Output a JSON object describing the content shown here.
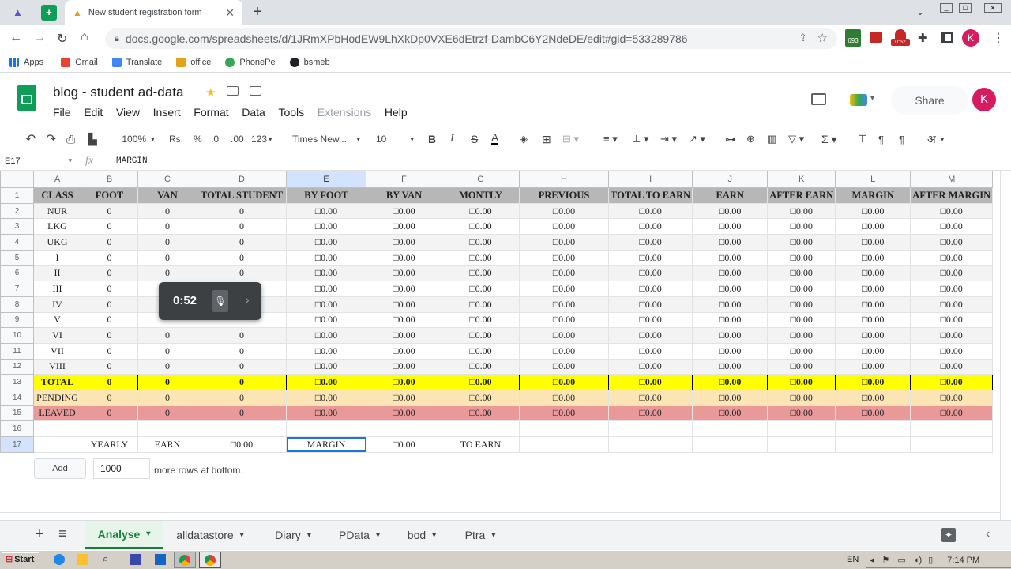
{
  "browser": {
    "tabs": [
      {
        "label": "New student registration form"
      }
    ],
    "new_tab_icon": "plus-icon",
    "url": "docs.google.com/spreadsheets/d/1JRmXPbHodEW9LhXkDp0VXE6dEtrzf-DambC6Y2NdeDE/edit#gid=533289786",
    "ext_badges": {
      "calendar": "693",
      "recorder": "0:52"
    },
    "profile_initial": "K"
  },
  "bookmarks": [
    {
      "label": "Apps"
    },
    {
      "label": "Gmail"
    },
    {
      "label": "Translate"
    },
    {
      "label": "office"
    },
    {
      "label": "PhonePe"
    },
    {
      "label": "bsmeb"
    }
  ],
  "doc": {
    "title": "blog - student ad-data",
    "menus": [
      "File",
      "Edit",
      "View",
      "Insert",
      "Format",
      "Data",
      "Tools",
      "Extensions",
      "Help"
    ],
    "share_label": "Share",
    "avatar": "K"
  },
  "toolbar": {
    "zoom": "100%",
    "currency": "Rs.",
    "percent": "%",
    "dec_less": ".0",
    "dec_more": ".00",
    "format": "123",
    "font": "Times New...",
    "size": "10",
    "bold": "B",
    "italic": "I",
    "strike": "S",
    "text_color": "A",
    "lang": "अ"
  },
  "formula": {
    "cell_ref": "E17",
    "fx": "fx",
    "content": "MARGIN"
  },
  "grid": {
    "columns": [
      "A",
      "B",
      "C",
      "D",
      "E",
      "F",
      "G",
      "H",
      "I",
      "J",
      "K",
      "L",
      "M"
    ],
    "selected_column": "E",
    "rows": [
      {
        "n": "1",
        "type": "hdr",
        "cells": [
          "CLASS",
          "FOOT",
          "VAN",
          "TOTAL STUDENT",
          "BY FOOT",
          "BY VAN",
          "MONTLY",
          "PREVIOUS",
          "TOTAL TO EARN",
          "EARN",
          "AFTER EARN",
          "MARGIN",
          "AFTER MARGIN"
        ]
      },
      {
        "n": "2",
        "type": "r2",
        "cells": [
          "NUR",
          "0",
          "0",
          "0",
          "□0.00",
          "□0.00",
          "□0.00",
          "□0.00",
          "□0.00",
          "□0.00",
          "□0.00",
          "□0.00",
          "□0.00"
        ]
      },
      {
        "n": "3",
        "type": "r3",
        "cells": [
          "LKG",
          "0",
          "0",
          "0",
          "□0.00",
          "□0.00",
          "□0.00",
          "□0.00",
          "□0.00",
          "□0.00",
          "□0.00",
          "□0.00",
          "□0.00"
        ]
      },
      {
        "n": "4",
        "type": "r4",
        "cells": [
          "UKG",
          "0",
          "0",
          "0",
          "□0.00",
          "□0.00",
          "□0.00",
          "□0.00",
          "□0.00",
          "□0.00",
          "□0.00",
          "□0.00",
          "□0.00"
        ]
      },
      {
        "n": "5",
        "type": "r5",
        "cells": [
          "I",
          "0",
          "0",
          "0",
          "□0.00",
          "□0.00",
          "□0.00",
          "□0.00",
          "□0.00",
          "□0.00",
          "□0.00",
          "□0.00",
          "□0.00"
        ]
      },
      {
        "n": "6",
        "type": "r6",
        "cells": [
          "II",
          "0",
          "0",
          "0",
          "□0.00",
          "□0.00",
          "□0.00",
          "□0.00",
          "□0.00",
          "□0.00",
          "□0.00",
          "□0.00",
          "□0.00"
        ]
      },
      {
        "n": "7",
        "type": "r7",
        "cells": [
          "III",
          "0",
          "",
          "",
          "□0.00",
          "□0.00",
          "□0.00",
          "□0.00",
          "□0.00",
          "□0.00",
          "□0.00",
          "□0.00",
          "□0.00"
        ]
      },
      {
        "n": "8",
        "type": "r8",
        "cells": [
          "IV",
          "0",
          "",
          "",
          "□0.00",
          "□0.00",
          "□0.00",
          "□0.00",
          "□0.00",
          "□0.00",
          "□0.00",
          "□0.00",
          "□0.00"
        ]
      },
      {
        "n": "9",
        "type": "r9",
        "cells": [
          "V",
          "0",
          "",
          "",
          "□0.00",
          "□0.00",
          "□0.00",
          "□0.00",
          "□0.00",
          "□0.00",
          "□0.00",
          "□0.00",
          "□0.00"
        ]
      },
      {
        "n": "10",
        "type": "r10",
        "cells": [
          "VI",
          "0",
          "0",
          "0",
          "□0.00",
          "□0.00",
          "□0.00",
          "□0.00",
          "□0.00",
          "□0.00",
          "□0.00",
          "□0.00",
          "□0.00"
        ]
      },
      {
        "n": "11",
        "type": "r11",
        "cells": [
          "VII",
          "0",
          "0",
          "0",
          "□0.00",
          "□0.00",
          "□0.00",
          "□0.00",
          "□0.00",
          "□0.00",
          "□0.00",
          "□0.00",
          "□0.00"
        ]
      },
      {
        "n": "12",
        "type": "r12",
        "cells": [
          "VIII",
          "0",
          "0",
          "0",
          "□0.00",
          "□0.00",
          "□0.00",
          "□0.00",
          "□0.00",
          "□0.00",
          "□0.00",
          "□0.00",
          "□0.00"
        ]
      },
      {
        "n": "13",
        "type": "total",
        "cells": [
          "TOTAL",
          "0",
          "0",
          "0",
          "□0.00",
          "□0.00",
          "□0.00",
          "□0.00",
          "□0.00",
          "□0.00",
          "□0.00",
          "□0.00",
          "□0.00"
        ]
      },
      {
        "n": "14",
        "type": "pending",
        "cells": [
          "PENDING",
          "0",
          "0",
          "0",
          "□0.00",
          "□0.00",
          "□0.00",
          "□0.00",
          "□0.00",
          "□0.00",
          "□0.00",
          "□0.00",
          "□0.00"
        ]
      },
      {
        "n": "15",
        "type": "leaved",
        "cells": [
          "LEAVED",
          "0",
          "0",
          "0",
          "□0.00",
          "□0.00",
          "□0.00",
          "□0.00",
          "□0.00",
          "□0.00",
          "□0.00",
          "□0.00",
          "□0.00"
        ]
      },
      {
        "n": "16",
        "type": "blank",
        "cells": [
          "",
          "",
          "",
          "",
          "",
          "",
          "",
          "",
          "",
          "",
          "",
          "",
          ""
        ]
      },
      {
        "n": "17",
        "type": "r17",
        "cells": [
          "",
          "YEARLY",
          "EARN",
          "□0.00",
          "MARGIN",
          "□0.00",
          "TO EARN",
          "",
          "",
          "",
          "",
          "",
          ""
        ]
      }
    ],
    "add_rows": {
      "button": "Add",
      "count": "1000",
      "suffix": "more rows at bottom."
    }
  },
  "recorder_popup": {
    "time": "0:52"
  },
  "sheets": [
    {
      "label": "Analyse",
      "active": true
    },
    {
      "label": "alldatastore"
    },
    {
      "label": "Diary"
    },
    {
      "label": "PData"
    },
    {
      "label": "bod"
    },
    {
      "label": "Ptra"
    }
  ],
  "taskbar": {
    "start": "Start",
    "lang": "EN",
    "time": "7:14 PM"
  }
}
